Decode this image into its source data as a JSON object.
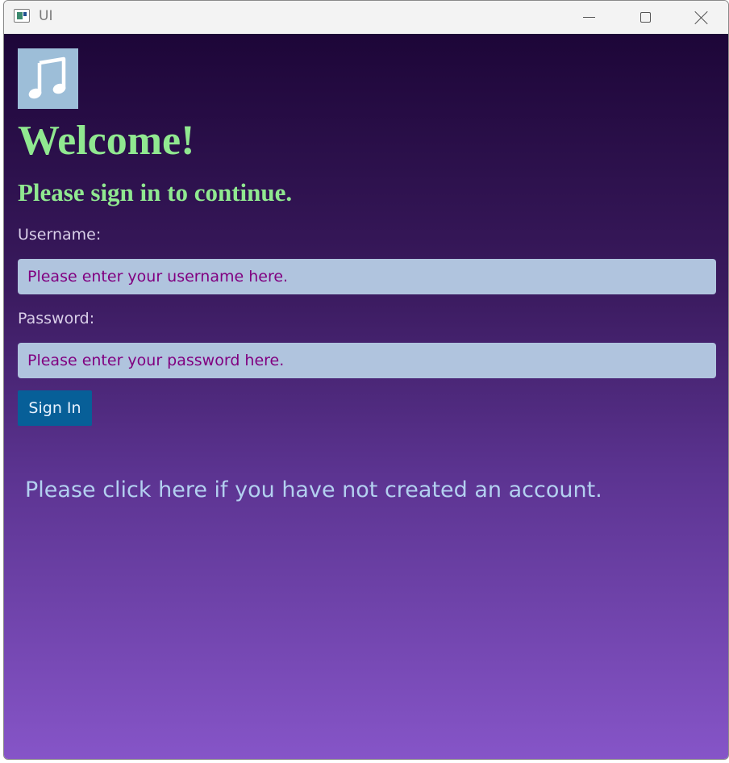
{
  "window": {
    "title": "UI"
  },
  "icons": {
    "app": "app-window-icon",
    "logo": "music-note-icon",
    "minimize": "minimize-icon",
    "maximize": "maximize-icon",
    "close": "close-icon"
  },
  "colors": {
    "heading": "#90e890",
    "field_bg": "#b0c4de",
    "field_text": "#800080",
    "button_bg": "#075f98",
    "link": "#b3d0f0",
    "gradient_top": "#1d0638",
    "gradient_bottom": "#8655c8"
  },
  "login": {
    "welcome": "Welcome!",
    "subtitle": "Please sign in to continue.",
    "username_label": "Username:",
    "username_placeholder": "Please enter your username here.",
    "password_label": "Password:",
    "password_placeholder": "Please enter your password here.",
    "signin_label": "Sign In",
    "register_link": "Please click here if you have not created an account."
  }
}
